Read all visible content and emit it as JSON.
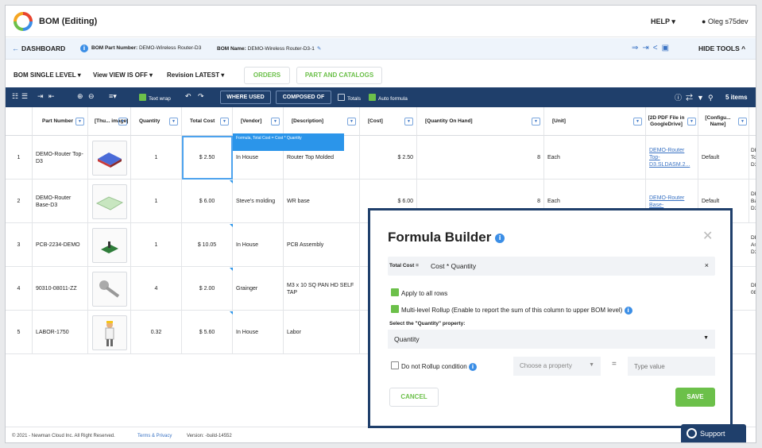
{
  "app": {
    "title": "BOM (Editing)",
    "help": "HELP ▾",
    "user": "Oleg s75dev"
  },
  "breadcrumb": {
    "dashboard": "DASHBOARD",
    "part_number_label": "BOM Part Number:",
    "part_number": "DEMO-Wireless Router-D3",
    "bom_name_label": "BOM Name:",
    "bom_name": "DEMO-Wireless Router-D3-1",
    "hide_tools": "HIDE TOOLS ^"
  },
  "selectors": {
    "bom_level": "BOM SINGLE LEVEL ▾",
    "view": "View VIEW IS OFF ▾",
    "revision": "Revision LATEST ▾",
    "orders": "ORDERS",
    "parts_catalogs": "PART AND CATALOGS"
  },
  "toolbar": {
    "text_wrap": "Text wrap",
    "where_used": "WHERE USED",
    "composed_of": "COMPOSED OF",
    "totals": "Totals",
    "auto_formula": "Auto formula",
    "item_count": "5 items"
  },
  "columns": [
    "Part Number",
    "[Thu... image]",
    "Quantity",
    "Total Cost",
    "[Vendor]",
    "[Description]",
    "[Cost]",
    "[Quantity On Hand]",
    "[Unit]",
    "[2D PDF File in GoogleDrive]",
    "[Configu... Name]"
  ],
  "formula_tip": "Formula, Total Cost = Cost * Quantity",
  "rows": [
    {
      "num": "1",
      "part": "DEMO-Router Top-D3",
      "qty": "1",
      "total": "$ 2.50",
      "vendor": "In House",
      "desc": "Router Top Molded",
      "cost": "$ 2.50",
      "onhand": "8",
      "unit": "Each",
      "pdf": "DEMO-Router Top-D3.SLDASM.2...",
      "config": "Default",
      "extra": "DE To D3"
    },
    {
      "num": "2",
      "part": "DEMO-Router Base-D3",
      "qty": "1",
      "total": "$ 6.00",
      "vendor": "Steve's molding",
      "desc": "WR base",
      "cost": "$ 6.00",
      "onhand": "8",
      "unit": "Each",
      "pdf": "DEMO-Router Base-",
      "config": "Default",
      "extra": "DE Ba D3"
    },
    {
      "num": "3",
      "part": "PCB-2234-DEMO",
      "qty": "1",
      "total": "$ 10.05",
      "vendor": "In House",
      "desc": "PCB Assembly",
      "cost": "",
      "onhand": "",
      "unit": "",
      "pdf": "",
      "config": "",
      "extra": "DE As D3"
    },
    {
      "num": "4",
      "part": "90310-08011-ZZ",
      "qty": "4",
      "total": "$ 2.00",
      "vendor": "Grainger",
      "desc": "M3 x 10 SQ PAN HD SELF TAP",
      "cost": "",
      "onhand": "",
      "unit": "",
      "pdf": "",
      "config": "",
      "extra": "DE 08"
    },
    {
      "num": "5",
      "part": "LABOR-1750",
      "qty": "0.32",
      "total": "$ 5.60",
      "vendor": "In House",
      "desc": "Labor",
      "cost": "",
      "onhand": "",
      "unit": "",
      "pdf": "",
      "config": "",
      "extra": ""
    }
  ],
  "footer": {
    "copyright": "© 2021 - Newman Cloud Inc. All Right Reserved.",
    "terms": "Terms & Privacy",
    "version": "Version: -build-14552",
    "support": "Support"
  },
  "modal": {
    "title": "Formula Builder",
    "formula_label": "Total Cost =",
    "formula": "Cost * Quantity",
    "apply_all": "Apply to all rows",
    "multi_rollup": "Multi-level Rollup (Enable to report the sum of this column to upper BOM level)",
    "select_label": "Select the \"Quantity\" property:",
    "selected_property": "Quantity",
    "no_rollup": "Do not Rollup condition",
    "choose_property": "Choose a property",
    "type_value": "Type value",
    "cancel": "CANCEL",
    "save": "SAVE"
  },
  "colors": {
    "navy": "#1f3f6b",
    "green": "#6cc04a",
    "blue": "#3a73c4"
  }
}
